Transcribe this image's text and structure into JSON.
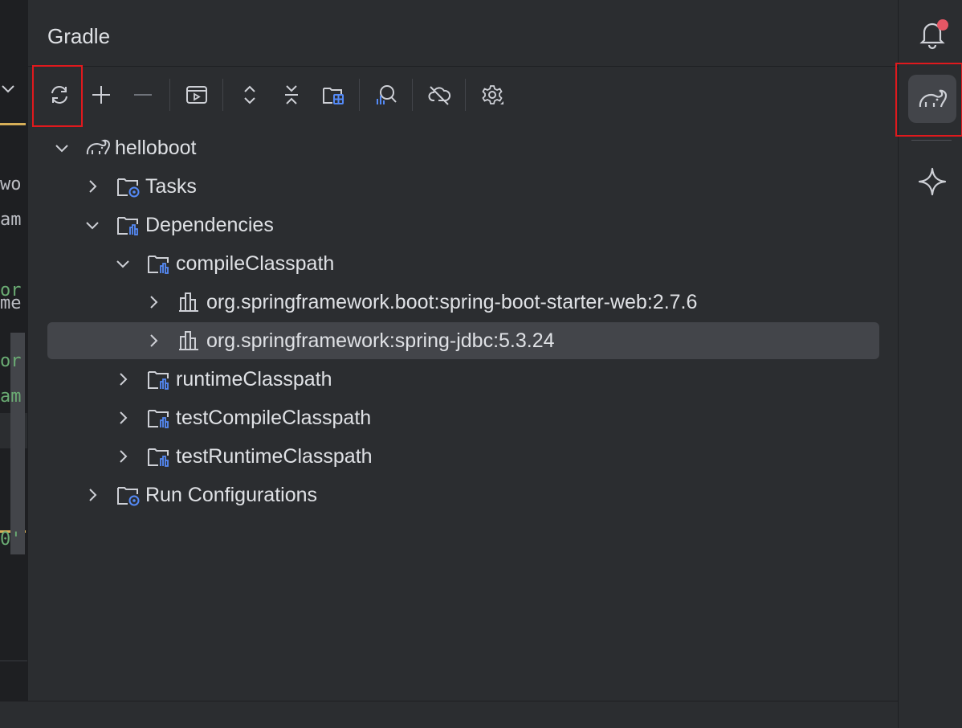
{
  "editor_fragments": [
    {
      "text": "wo",
      "color": "#bcbec4"
    },
    {
      "text": "am",
      "color": "#bcbec4"
    },
    {
      "text": "or",
      "color": "#6aab73"
    },
    {
      "text": "me",
      "color": "#bcbec4"
    },
    {
      "text": "or",
      "color": "#6aab73"
    },
    {
      "text": "am",
      "color": "#6aab73"
    },
    {
      "text": "0'",
      "color": "#6aab73"
    }
  ],
  "panel": {
    "title": "Gradle"
  },
  "toolbar": {
    "buttons": [
      {
        "name": "reload-all-gradle-projects",
        "icon": "refresh-icon"
      },
      {
        "name": "link-gradle-project",
        "icon": "plus-icon"
      },
      {
        "name": "unlink-gradle-project",
        "icon": "minus-icon"
      },
      {
        "name": "execute-gradle-task",
        "icon": "run-window-icon"
      },
      {
        "name": "expand-all",
        "icon": "expand-all-icon"
      },
      {
        "name": "collapse-all",
        "icon": "collapse-all-icon"
      },
      {
        "name": "group-modules",
        "icon": "folder-grid-icon"
      },
      {
        "name": "analyze-dependencies",
        "icon": "analyze-icon"
      },
      {
        "name": "toggle-offline-mode",
        "icon": "cloud-off-icon"
      },
      {
        "name": "build-tool-settings",
        "icon": "gear-icon"
      }
    ]
  },
  "tree": {
    "root": {
      "label": "helloboot",
      "expanded": true
    },
    "tasks": {
      "label": "Tasks",
      "expanded": false
    },
    "dependencies": {
      "label": "Dependencies",
      "expanded": true
    },
    "compile_classpath": {
      "label": "compileClasspath",
      "expanded": true
    },
    "dep_web": {
      "label": "org.springframework.boot:spring-boot-starter-web:2.7.6",
      "expanded": false
    },
    "dep_jdbc": {
      "label": "org.springframework:spring-jdbc:5.3.24",
      "expanded": false,
      "selected": true
    },
    "runtime_classpath": {
      "label": "runtimeClasspath",
      "expanded": false
    },
    "test_compile_classpath": {
      "label": "testCompileClasspath",
      "expanded": false
    },
    "test_runtime_classpath": {
      "label": "testRuntimeClasspath",
      "expanded": false
    },
    "run_configurations": {
      "label": "Run Configurations",
      "expanded": false
    }
  },
  "right_stripe": {
    "items": [
      {
        "name": "notifications",
        "icon": "bell-icon",
        "has_badge": true
      },
      {
        "name": "gradle",
        "icon": "gradle-elephant-icon",
        "active": true
      },
      {
        "name": "ai-assistant",
        "icon": "sparkle-icon"
      }
    ]
  },
  "colors": {
    "panel_bg": "#2b2d30",
    "editor_bg": "#1e1f22",
    "selection": "#43454a",
    "highlight_box": "#e0191d",
    "icon_fg": "#ced0d6",
    "icon_accent": "#548af7",
    "badge": "#e55765"
  }
}
